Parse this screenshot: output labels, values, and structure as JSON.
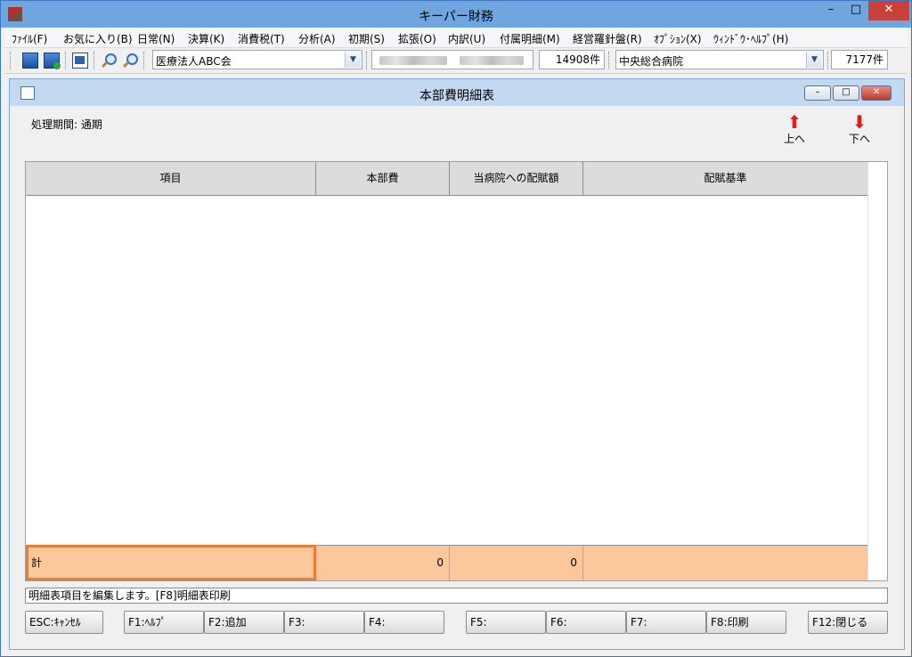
{
  "app": {
    "title": "キーパー財務"
  },
  "window_controls": {
    "minimize": "–",
    "maximize": "□",
    "close": "✕"
  },
  "menu": [
    "ﾌｧｲﾙ(F)",
    "お気に入り(B)",
    "日常(N)",
    "決算(K)",
    "消費税(T)",
    "分析(A)",
    "初期(S)",
    "拡張(O)",
    "内訳(U)",
    "付属明細(M)",
    "経営羅針盤(R)",
    "ｵﾌﾟｼｮﾝ(X)",
    "ｳｨﾝﾄﾞｳ･ﾍﾙﾌﾟ(H)"
  ],
  "toolbar": {
    "corporation": "医療法人ABC会",
    "corporation_count": "14908件",
    "facility": "中央総合病院",
    "facility_count": "7177件"
  },
  "child": {
    "title": "本部費明細表",
    "period_label": "処理期間: 通期",
    "up_label": "上へ",
    "down_label": "下へ",
    "up_glyph": "⬆",
    "down_glyph": "⬇"
  },
  "grid": {
    "headers": [
      "項目",
      "本部費",
      "当病院への配賦額",
      "配賦基準"
    ],
    "total_label": "計",
    "total_values": [
      "0",
      "0",
      ""
    ]
  },
  "status_text": "明細表項目を編集します。[F8]明細表印刷",
  "fkeys": [
    "ESC:ｷｬﾝｾﾙ",
    "F1:ﾍﾙﾌﾟ",
    "F2:追加",
    "F3:",
    "F4:",
    "F5:",
    "F6:",
    "F7:",
    "F8:印刷",
    "F12:閉じる"
  ],
  "icons": [
    "app-icon",
    "save-icon",
    "save-as-icon",
    "open-icon",
    "zoom-in-icon",
    "zoom-out-icon",
    "combo-arrow-icon",
    "up-arrow-icon",
    "down-arrow-icon"
  ]
}
